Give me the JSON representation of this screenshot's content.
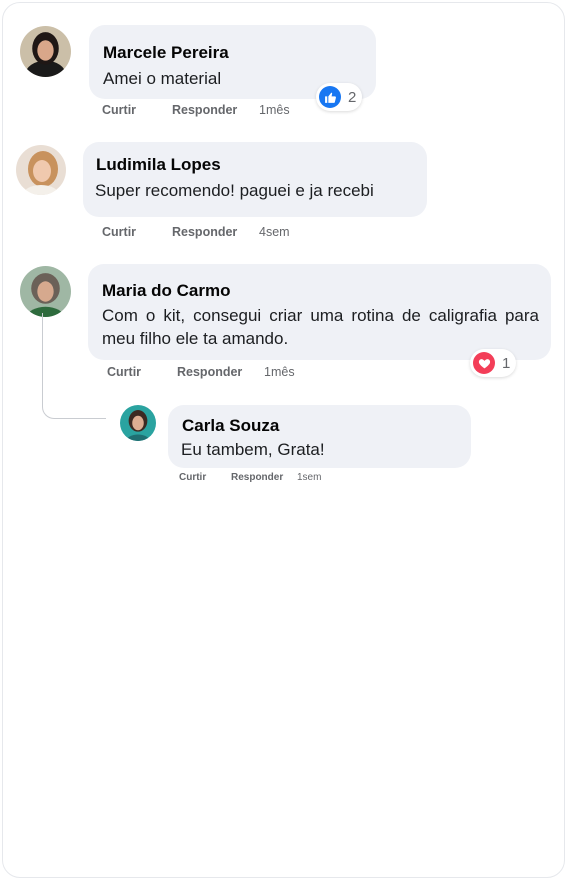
{
  "comments": [
    {
      "name": "Marcele Pereira",
      "text": "Amei o material",
      "actions": {
        "like": "Curtir",
        "reply": "Responder",
        "time": "1mês"
      },
      "reaction": {
        "icon": "like-icon",
        "count": "2",
        "color": "#1877f2"
      }
    },
    {
      "name": "Ludimila Lopes",
      "text": "Super recomendo! paguei e ja recebi",
      "actions": {
        "like": "Curtir",
        "reply": "Responder",
        "time": "4sem"
      }
    },
    {
      "name": "Maria do Carmo",
      "text": "Com o kit, consegui criar uma rotina de caligrafia para meu filho ele ta amando.",
      "actions": {
        "like": "Curtir",
        "reply": "Responder",
        "time": "1mês"
      },
      "reaction": {
        "icon": "heart-icon",
        "count": "1",
        "color": "#f33e58"
      }
    },
    {
      "name": "Carla Souza",
      "text": "Eu tambem, Grata!",
      "actions": {
        "like": "Curtir",
        "reply": "Responder",
        "time": "1sem"
      }
    }
  ],
  "colors": {
    "bubble": "#eff1f6",
    "muted": "#65676b",
    "like": "#1877f2",
    "love": "#f33e58"
  }
}
